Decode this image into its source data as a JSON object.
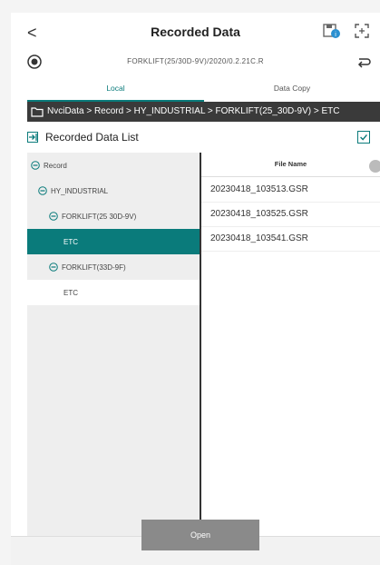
{
  "header": {
    "back": "<",
    "title": "Recorded Data"
  },
  "device": {
    "label": "FORKLIFT(25/30D-9V)/2020/0.2.21C.R"
  },
  "tabs": [
    {
      "label": "Local"
    },
    {
      "label": "Data Copy"
    }
  ],
  "path": "NvciData > Record > HY_INDUSTRIAL > FORKLIFT(25_30D-9V) > ETC",
  "list_title": "Recorded Data List",
  "tree": [
    {
      "label": "Record"
    },
    {
      "label": "HY_INDUSTRIAL"
    },
    {
      "label": "FORKLIFT(25 30D-9V)"
    },
    {
      "label": "ETC"
    },
    {
      "label": "FORKLIFT(33D-9F)"
    },
    {
      "label": "ETC"
    }
  ],
  "files": {
    "header": "File Name",
    "rows": [
      "20230418_103513.GSR",
      "20230418_103525.GSR",
      "20230418_103541.GSR"
    ]
  },
  "open_label": "Open",
  "colors": {
    "accent": "#0a7b7b",
    "path_bg": "#3a3a3a"
  }
}
